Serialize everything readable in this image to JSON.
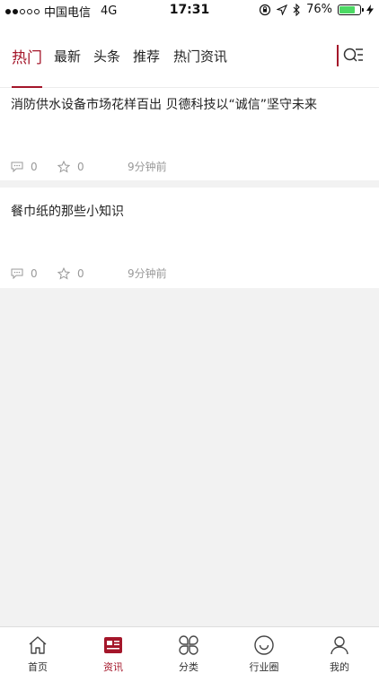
{
  "status_bar": {
    "carrier": "中国电信",
    "network": "4G",
    "time": "17:31",
    "battery_pct": "76%",
    "battery_level": 0.76
  },
  "tabs": [
    {
      "label": "热门",
      "active": true
    },
    {
      "label": "最新",
      "active": false
    },
    {
      "label": "头条",
      "active": false
    },
    {
      "label": "推荐",
      "active": false
    },
    {
      "label": "热门资讯",
      "active": false
    }
  ],
  "articles": [
    {
      "title": "消防供水设备市场花样百出 贝德科技以“诚信”坚守未来",
      "comments": "0",
      "favorites": "0",
      "time": "9分钟前"
    },
    {
      "title": "餐巾纸的那些小知识",
      "comments": "0",
      "favorites": "0",
      "time": "9分钟前"
    }
  ],
  "bottom_nav": [
    {
      "label": "首页",
      "icon": "home-icon"
    },
    {
      "label": "资讯",
      "icon": "news-icon",
      "active": true
    },
    {
      "label": "分类",
      "icon": "category-icon"
    },
    {
      "label": "行业圈",
      "icon": "circle-icon"
    },
    {
      "label": "我的",
      "icon": "profile-icon"
    }
  ],
  "colors": {
    "accent": "#a4162a",
    "background": "#f2f2f2",
    "battery": "#4cd964"
  }
}
